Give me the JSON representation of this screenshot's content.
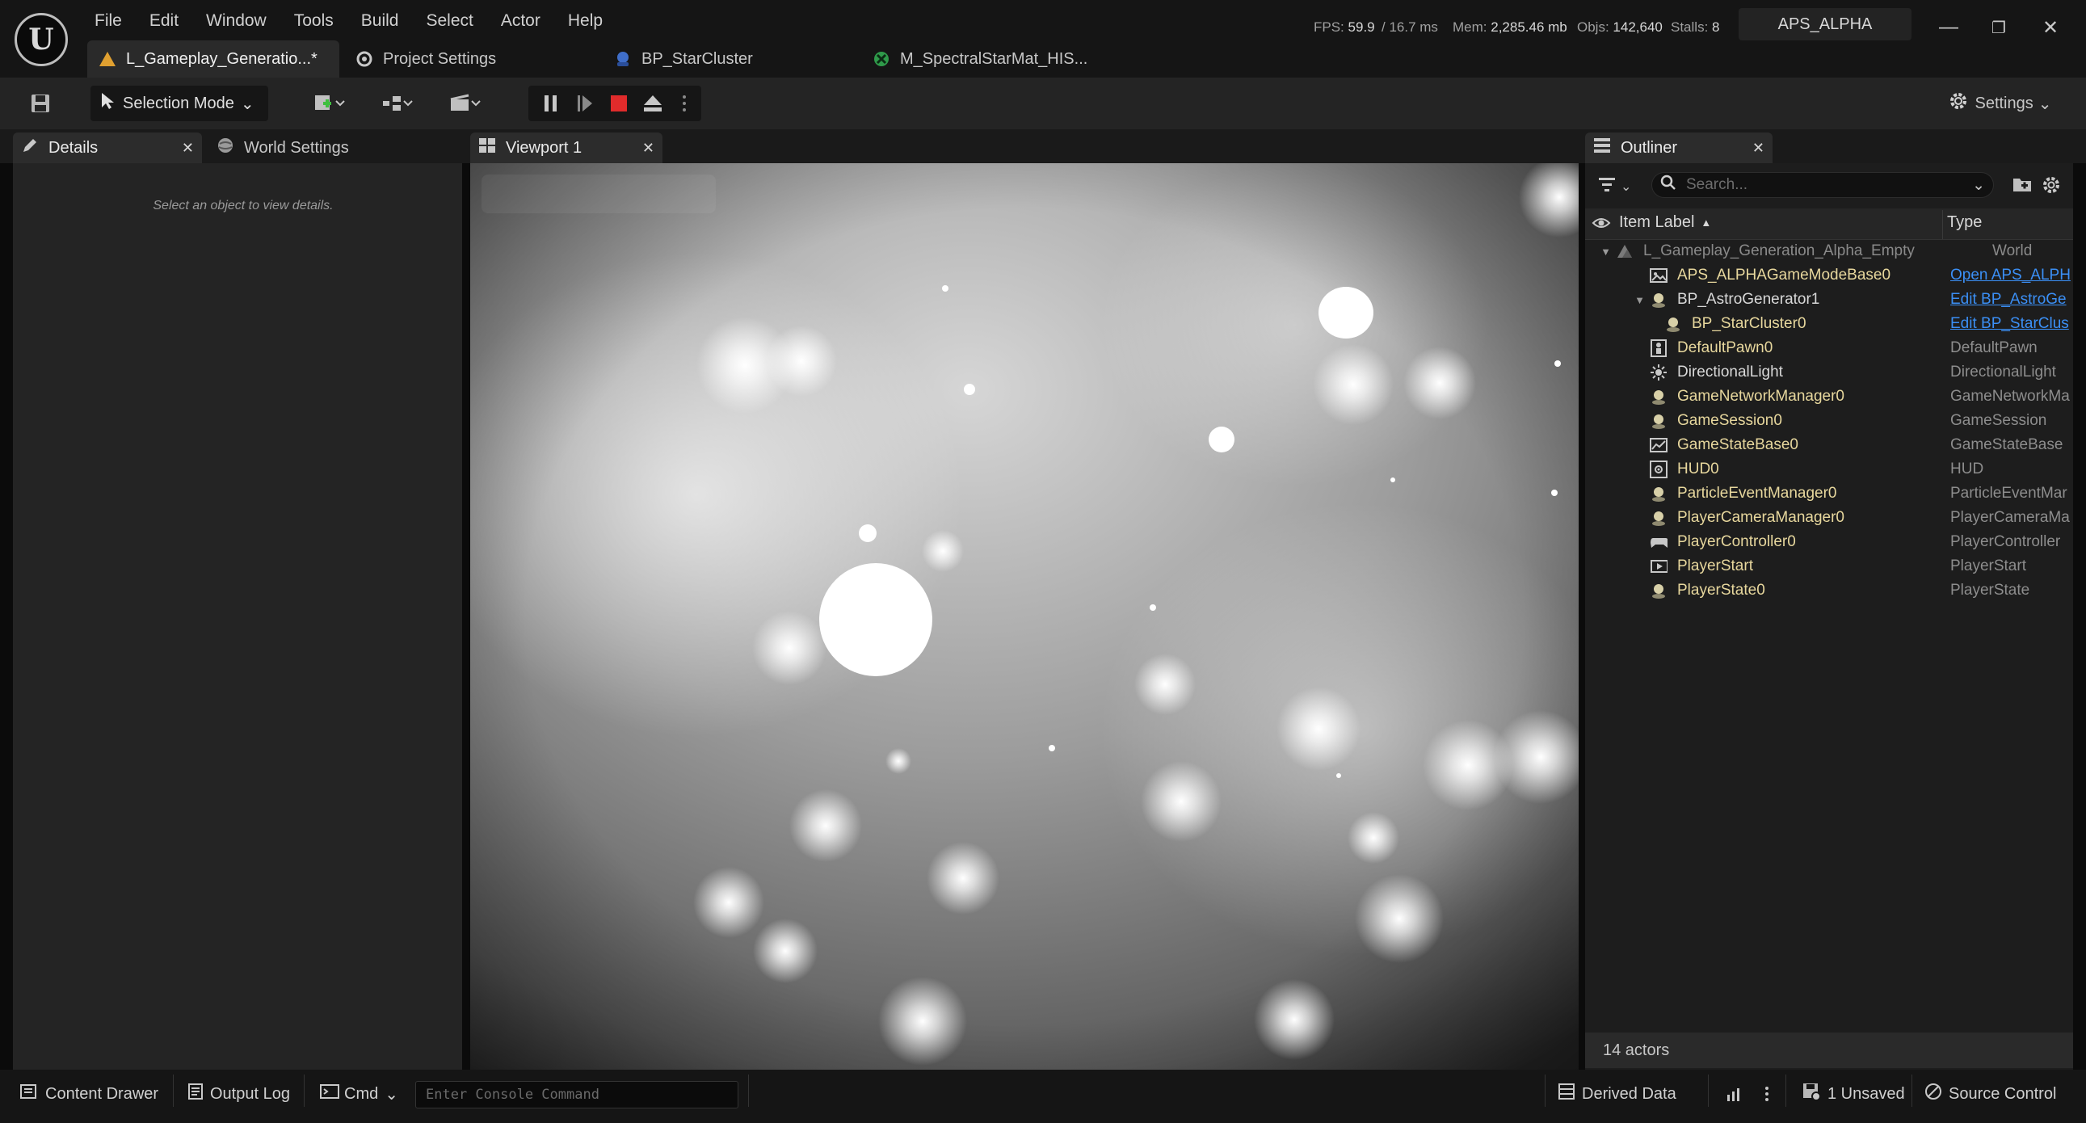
{
  "menu": [
    "File",
    "Edit",
    "Window",
    "Tools",
    "Build",
    "Select",
    "Actor",
    "Help"
  ],
  "stats": {
    "fps_label": "FPS:",
    "fps": "59.9",
    "ms": "/ 16.7 ms",
    "mem_label": "Mem:",
    "mem": "2,285.46 mb",
    "objs_label": "Objs:",
    "objs": "142,640",
    "stalls_label": "Stalls:",
    "stalls": "8"
  },
  "project_name": "APS_ALPHA",
  "doc_tabs": [
    {
      "label": "L_Gameplay_Generatio...*"
    },
    {
      "label": "Project Settings"
    },
    {
      "label": "BP_StarCluster"
    },
    {
      "label": "M_SpectralStarMat_HIS..."
    }
  ],
  "toolbar": {
    "selection_mode": "Selection Mode",
    "settings": "Settings"
  },
  "panels": {
    "details_tab": "Details",
    "world_settings_tab": "World Settings",
    "details_hint": "Select an object to view details.",
    "viewport_tab": "Viewport 1",
    "outliner_tab": "Outliner",
    "search_placeholder": "Search...",
    "col_label": "Item Label",
    "col_type": "Type",
    "actor_count": "14 actors"
  },
  "outliner_rows": [
    {
      "label": "L_Gameplay_Generation_Alpha_Empty",
      "type": "World",
      "icon": "level-icon"
    },
    {
      "label": "APS_ALPHAGameModeBase0",
      "type": "Open APS_ALPH",
      "icon": "gamemode-icon",
      "link": true
    },
    {
      "label": "BP_AstroGenerator1",
      "type": "Edit BP_AstroGe",
      "icon": "actor-icon",
      "link": true
    },
    {
      "label": "BP_StarCluster0",
      "type": "Edit BP_StarClus",
      "icon": "actor-icon",
      "link": true
    },
    {
      "label": "DefaultPawn0",
      "type": "DefaultPawn",
      "icon": "pawn-icon"
    },
    {
      "label": "DirectionalLight",
      "type": "DirectionalLight",
      "icon": "sun-icon"
    },
    {
      "label": "GameNetworkManager0",
      "type": "GameNetworkMa",
      "icon": "actor-icon"
    },
    {
      "label": "GameSession0",
      "type": "GameSession",
      "icon": "actor-icon"
    },
    {
      "label": "GameStateBase0",
      "type": "GameStateBase",
      "icon": "gamestate-icon"
    },
    {
      "label": "HUD0",
      "type": "HUD",
      "icon": "hud-icon"
    },
    {
      "label": "ParticleEventManager0",
      "type": "ParticleEventMar",
      "icon": "actor-icon"
    },
    {
      "label": "PlayerCameraManager0",
      "type": "PlayerCameraMa",
      "icon": "actor-icon"
    },
    {
      "label": "PlayerController0",
      "type": "PlayerController",
      "icon": "gamepad-icon"
    },
    {
      "label": "PlayerStart",
      "type": "PlayerStart",
      "icon": "playerstart-icon"
    },
    {
      "label": "PlayerState0",
      "type": "PlayerState",
      "icon": "actor-icon"
    }
  ],
  "statusbar": {
    "content_drawer": "Content Drawer",
    "output_log": "Output Log",
    "cmd": "Cmd",
    "console_placeholder": "Enter Console Command",
    "derived_data": "Derived Data",
    "unsaved": "1 Unsaved",
    "source_control": "Source Control"
  }
}
